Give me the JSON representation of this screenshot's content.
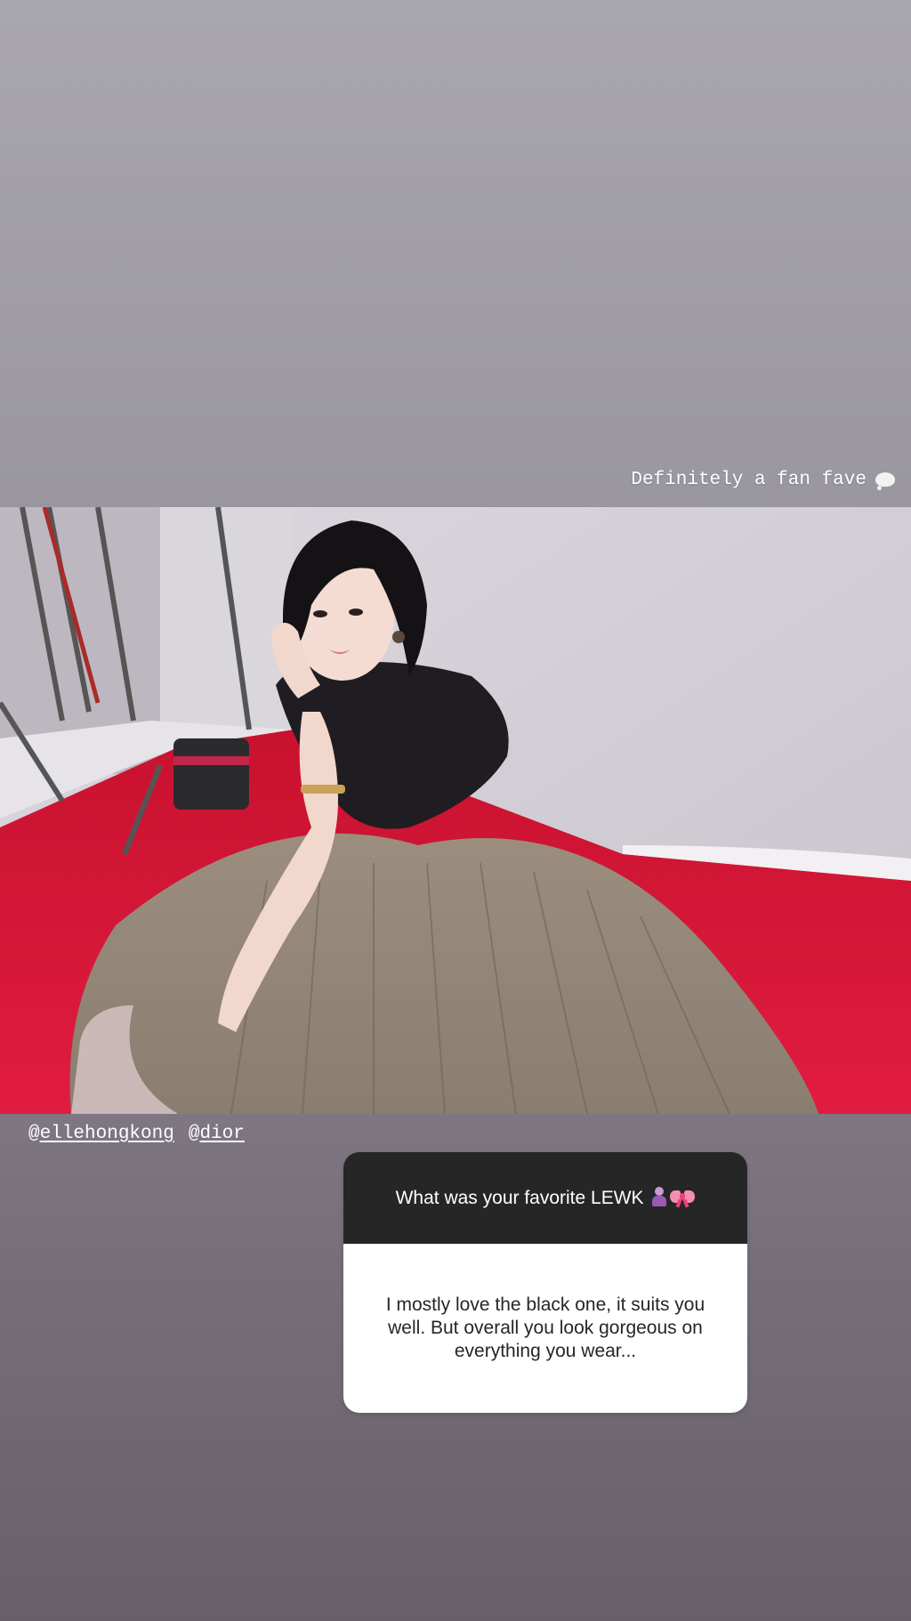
{
  "story": {
    "caption": "Definitely a fan fave",
    "caption_icon": "thought-bubble-icon",
    "mentions": [
      {
        "at": "@",
        "handle": "ellehongkong"
      },
      {
        "at": "@",
        "handle": "dior"
      }
    ]
  },
  "question_sticker": {
    "question": "What was your favorite LEWK",
    "question_icons": [
      "woman-dancing-emoji",
      "ribbon-emoji"
    ],
    "answer": "I mostly love the black one, it suits you well. But overall you look gorgeous on everything you wear..."
  },
  "colors": {
    "carpet": "#d81a3a",
    "card_header": "#262626",
    "card_body": "#ffffff"
  }
}
